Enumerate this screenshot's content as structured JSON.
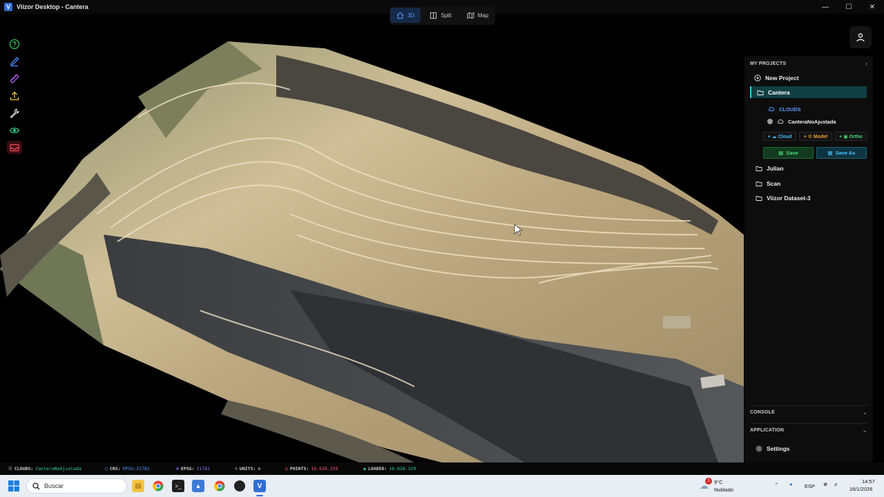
{
  "window": {
    "title": "Viizor Desktop - Cantera",
    "logo_letter": "V"
  },
  "view_tabs": [
    {
      "label": "3D",
      "icon": "home-icon",
      "active": true
    },
    {
      "label": "Split",
      "icon": "split-icon",
      "active": false
    },
    {
      "label": "Map",
      "icon": "map-icon",
      "active": false
    }
  ],
  "toolbar": [
    {
      "name": "help-icon",
      "color": "#34c759"
    },
    {
      "name": "pen-icon",
      "color": "#4f8cff"
    },
    {
      "name": "ruler-icon",
      "color": "#c061ff"
    },
    {
      "name": "upload-icon",
      "color": "#f2c744"
    },
    {
      "name": "wrench-icon",
      "color": "#e0e0e0"
    },
    {
      "name": "eye-icon",
      "color": "#22c88a"
    },
    {
      "name": "inbox-icon",
      "color": "#ff4d5a"
    }
  ],
  "projects": {
    "header": "MY PROJECTS",
    "new_project": "New Project",
    "active_project": "Cantera",
    "clouds_label": "CLOUDS",
    "cloud_item": "CanteraNoAjustada",
    "add_cloud": "+ ☁ Cloud",
    "add_model": "+ ⚙ Model",
    "add_ortho": "+ ▣ Ortho",
    "save": "Save",
    "save_as": "Save As",
    "other_projects": [
      "Julian",
      "Scan",
      "Viizor Dataset-3"
    ]
  },
  "console": {
    "label": "CONSOLE"
  },
  "application": {
    "label": "APPLICATION",
    "settings": "Settings"
  },
  "status": {
    "clouds_key": "CLOUDS:",
    "clouds_val": "CanteraNoAjustada",
    "crs_key": "CRS:",
    "crs_val": "EPSG:21781",
    "epsg_key": "EPSG:",
    "epsg_val": "21781",
    "units_key": "UNITS:",
    "units_val": "m",
    "points_key": "POINTS:",
    "points_val": "16.628.329",
    "loaded_key": "LOADED:",
    "loaded_val": "16.628.329"
  },
  "taskbar": {
    "search_placeholder": "Buscar",
    "weather_temp": "9°C",
    "weather_desc": "Nublado",
    "lang": "ESP",
    "time": "14:57",
    "date": "16/1/2026",
    "notif_count": "1"
  }
}
